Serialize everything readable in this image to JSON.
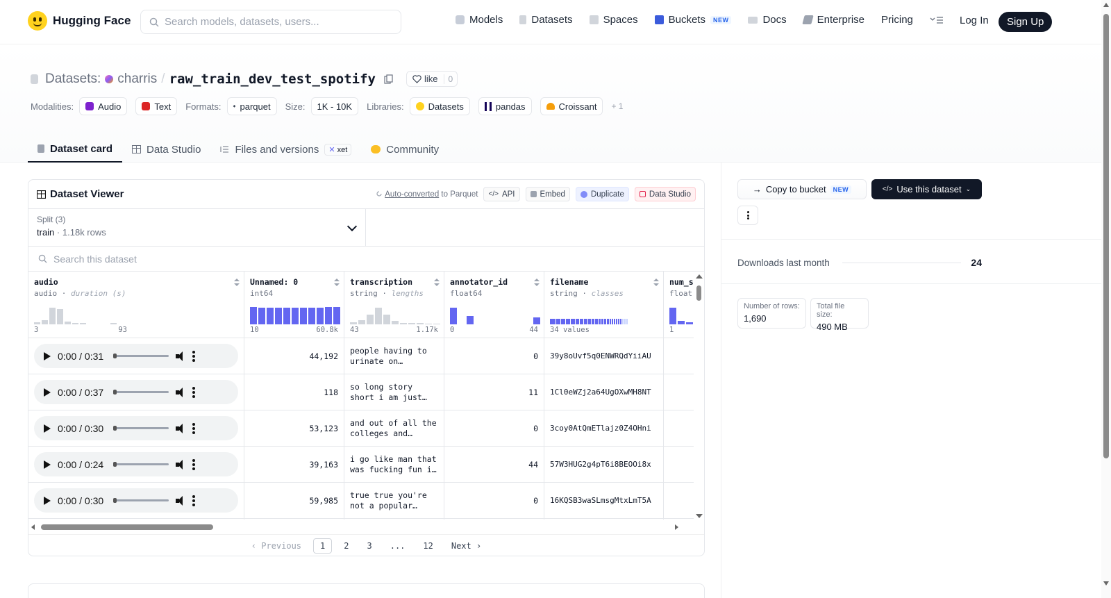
{
  "nav": {
    "brand": "Hugging Face",
    "search_placeholder": "Search models, datasets, users...",
    "links": [
      {
        "label": "Models",
        "icon": "models-icon"
      },
      {
        "label": "Datasets",
        "icon": "datasets-icon"
      },
      {
        "label": "Spaces",
        "icon": "spaces-icon"
      },
      {
        "label": "Buckets",
        "icon": "buckets-icon",
        "badge": "NEW"
      },
      {
        "label": "Docs",
        "icon": "docs-icon"
      },
      {
        "label": "Enterprise",
        "icon": "enterprise-icon"
      },
      {
        "label": "Pricing"
      }
    ],
    "login": "Log In",
    "signup": "Sign Up"
  },
  "header": {
    "prefix": "Datasets:",
    "user": "charris",
    "separator": "/",
    "dataset": "raw_train_dev_test_spotify",
    "like_label": "like",
    "like_count": "0",
    "modalities_label": "Modalities:",
    "modalities": [
      "Audio",
      "Text"
    ],
    "formats_label": "Formats:",
    "formats": [
      "parquet"
    ],
    "size_label": "Size:",
    "size": "1K - 10K",
    "libraries_label": "Libraries:",
    "libraries": [
      "Datasets",
      "pandas",
      "Croissant"
    ],
    "libraries_more": "+ 1"
  },
  "tabs": [
    {
      "label": "Dataset card",
      "active": true
    },
    {
      "label": "Data Studio"
    },
    {
      "label": "Files and versions",
      "badge": "xet"
    },
    {
      "label": "Community"
    }
  ],
  "viewer": {
    "title": "Dataset Viewer",
    "autoconv_link": "Auto-converted",
    "autoconv_rest": " to Parquet",
    "buttons": [
      "API",
      "Embed",
      "Duplicate",
      "Data Studio"
    ],
    "split_label": "Split (3)",
    "split_value": "train",
    "split_rows": "1.18k rows",
    "search_placeholder": "Search this dataset",
    "columns": [
      {
        "name": "audio",
        "type": "audio",
        "stat": "duration (s)",
        "min": "3",
        "max": "93"
      },
      {
        "name": "Unnamed: 0",
        "type": "int64",
        "stat": "",
        "min": "10",
        "max": "60.8k"
      },
      {
        "name": "transcription",
        "type": "string",
        "stat": "lengths",
        "min": "43",
        "max": "1.17k"
      },
      {
        "name": "annotator_id",
        "type": "float64",
        "stat": "",
        "min": "0",
        "max": "44"
      },
      {
        "name": "filename",
        "type": "string",
        "stat": "classes",
        "min": "34 values",
        "max": ""
      },
      {
        "name": "num_s",
        "type": "float",
        "stat": "",
        "min": "1",
        "max": ""
      }
    ],
    "rows": [
      {
        "time": "0:00 / 0:31",
        "unnamed": "44,192",
        "transcription": "people having to urinate on…",
        "annotator": "0",
        "filename": "39y8oUvf5q0ENWRQdYiiAU"
      },
      {
        "time": "0:00 / 0:37",
        "unnamed": "118",
        "transcription": "so long story short i am just…",
        "annotator": "11",
        "filename": "1Cl0eWZj2a64UgOXwMH8NT"
      },
      {
        "time": "0:00 / 0:30",
        "unnamed": "53,123",
        "transcription": "and out of all the colleges and…",
        "annotator": "0",
        "filename": "3coy0AtQmETlajz0Z4OHni"
      },
      {
        "time": "0:00 / 0:24",
        "unnamed": "39,163",
        "transcription": "i go like man that was fucking fun i…",
        "annotator": "44",
        "filename": "57W3HUG2g4pT6i8BEOOi8x"
      },
      {
        "time": "0:00 / 0:30",
        "unnamed": "59,985",
        "transcription": "true true you're not a popular…",
        "annotator": "0",
        "filename": "16KQSB3waSLmsgMtxLmT5A"
      }
    ],
    "pager": {
      "prev": "Previous",
      "pages": [
        "1",
        "2",
        "3",
        "...",
        "12"
      ],
      "current": "1",
      "next": "Next"
    }
  },
  "sidebar": {
    "copy_label": "Copy to bucket",
    "copy_badge": "NEW",
    "use_label": "Use this dataset",
    "downloads_label": "Downloads last month",
    "downloads_value": "24",
    "rows_label": "Number of rows:",
    "rows_value": "1,690",
    "size_label": "Total file size:",
    "size_value": "490 MB"
  }
}
